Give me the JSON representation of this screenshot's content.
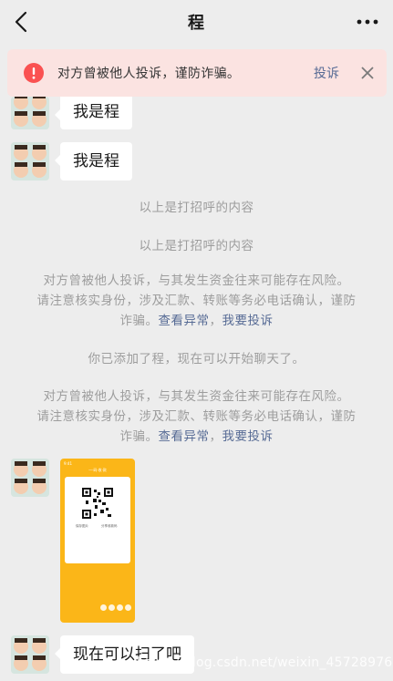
{
  "header": {
    "title": "程"
  },
  "warning": {
    "text": "对方曾被他人投诉，谨防诈骗。",
    "action": "投诉"
  },
  "messages": {
    "partial": "我是程",
    "m1": "我是程",
    "last": "现在可以扫了吧"
  },
  "system": {
    "greet1": "以上是打招呼的内容",
    "greet2": "以上是打招呼的内容",
    "risk1_line1": "对方曾被他人投诉，与其发生资金往来可能存在风险。",
    "risk1_line2": "请注意核实身份，涉及汇款、转账等务必电话确认，谨防",
    "risk1_line3_prefix": "诈骗。",
    "risk1_link1": "查看异常",
    "risk1_sep": "，",
    "risk1_link2": "我要投诉",
    "added": "你已添加了程，现在可以开始聊天了。",
    "risk2_line1": "对方曾被他人投诉，与其发生资金往来可能存在风险。",
    "risk2_line2_prefix": "请注意核实身份，涉及汇款、转账等务必电话确认，谨防",
    "risk2_line3_prefix": "诈骗。",
    "risk2_link1": "查看异常",
    "risk2_sep": "，",
    "risk2_link2": "我要投诉"
  },
  "image_message": {
    "status": "9:41",
    "title": "一·码·收·款",
    "qr_label_1": "保存图片",
    "qr_label_2": "分享收款码"
  },
  "watermark": "https://blog.csdn.net/weixin_45728976",
  "colors": {
    "link": "#576b95",
    "warning_bg": "#fbe3e1",
    "warning_icon": "#fa5151",
    "image_bg": "#fbb618"
  }
}
